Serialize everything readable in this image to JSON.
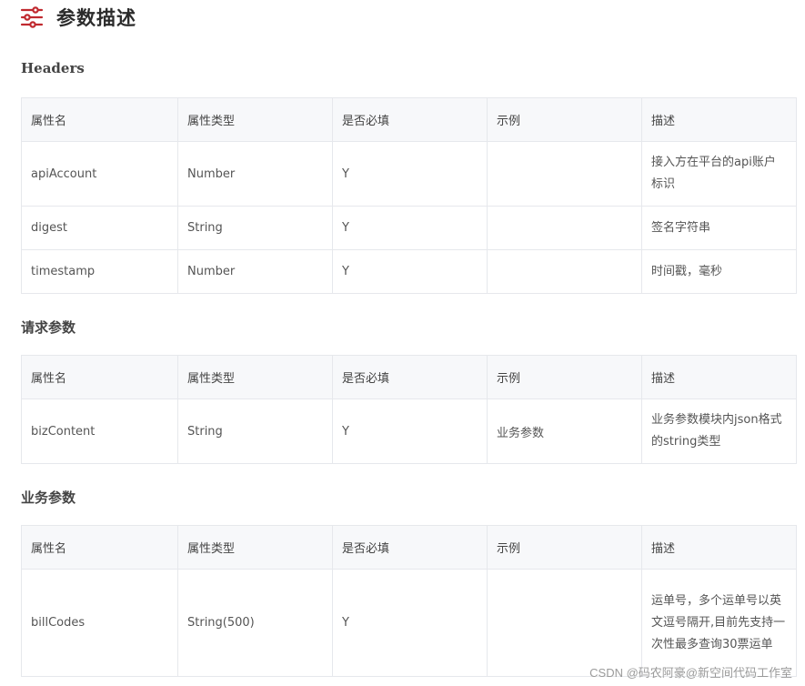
{
  "page": {
    "title": "参数描述",
    "icon": "sliders-icon",
    "accent_color": "#c0292f"
  },
  "columns": [
    "属性名",
    "属性类型",
    "是否必填",
    "示例",
    "描述"
  ],
  "sections": [
    {
      "title": "Headers",
      "rows": [
        {
          "name": "apiAccount",
          "type": "Number",
          "required": "Y",
          "example": "",
          "desc": "接入方在平台的api账户标识"
        },
        {
          "name": "digest",
          "type": "String",
          "required": "Y",
          "example": "",
          "desc": "签名字符串"
        },
        {
          "name": "timestamp",
          "type": "Number",
          "required": "Y",
          "example": "",
          "desc": "时间戳，毫秒"
        }
      ]
    },
    {
      "title": "请求参数",
      "rows": [
        {
          "name": "bizContent",
          "type": "String",
          "required": "Y",
          "example": "业务参数",
          "desc": "业务参数模块内json格式的string类型"
        }
      ]
    },
    {
      "title": "业务参数",
      "rows": [
        {
          "name": "billCodes",
          "type": "String(500)",
          "required": "Y",
          "example": "",
          "desc": "运单号，多个运单号以英文逗号隔开,目前先支持一次性最多查询30票运单"
        }
      ]
    }
  ],
  "watermark": "CSDN @码农阿豪@新空间代码工作室"
}
